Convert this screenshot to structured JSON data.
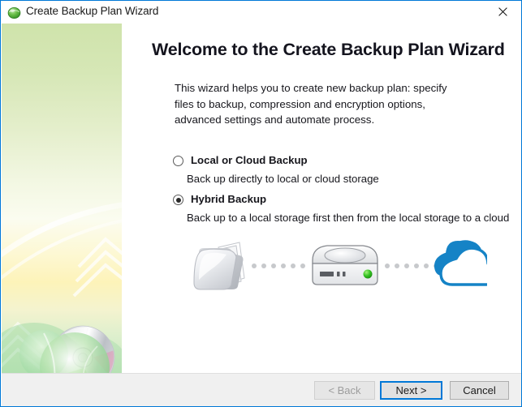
{
  "window": {
    "title": "Create Backup Plan Wizard",
    "icon": "green-globe-icon",
    "close_label": "close-icon",
    "border_color": "#0078d7"
  },
  "content": {
    "heading": "Welcome to the Create Backup Plan Wizard",
    "description": "This wizard helps you to create new backup plan: specify files to backup, compression and encryption options, advanced settings and automate process.",
    "options": [
      {
        "id": "local-or-cloud-backup",
        "label": "Local or Cloud Backup",
        "description": "Back up directly to local or cloud storage",
        "selected": false
      },
      {
        "id": "hybrid-backup",
        "label": "Hybrid Backup",
        "description": "Back up to a local storage first then from the local storage to a cloud",
        "selected": true
      }
    ],
    "illustration": {
      "nodes": [
        "folder-icon",
        "external-drive-icon",
        "cloud-icon"
      ],
      "connector": "dotted-line",
      "drive_led_color": "#2fbf1f",
      "cloud_color": "#1583c6",
      "folder_color": "#e9ebee"
    }
  },
  "footer": {
    "buttons": [
      {
        "id": "back",
        "label": "< Back",
        "enabled": false,
        "focused": false
      },
      {
        "id": "next",
        "label": "Next >",
        "enabled": true,
        "focused": true
      },
      {
        "id": "cancel",
        "label": "Cancel",
        "enabled": true,
        "focused": false
      }
    ]
  }
}
